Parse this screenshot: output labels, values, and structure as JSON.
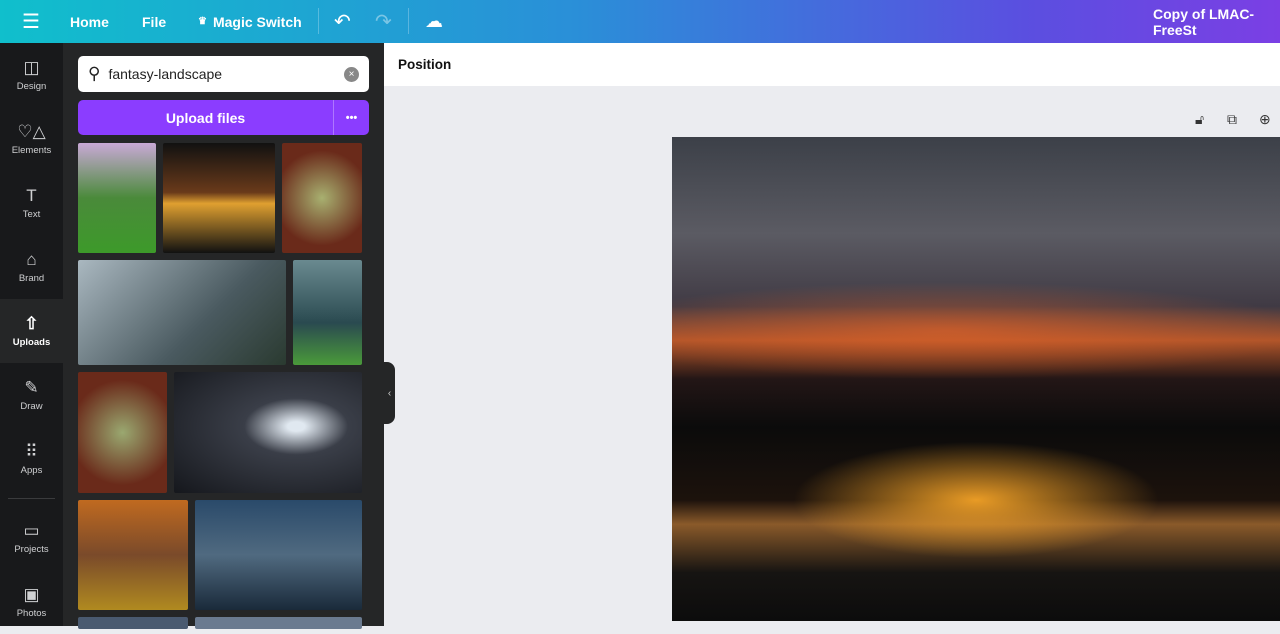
{
  "topbar": {
    "home": "Home",
    "file": "File",
    "magic_switch": "Magic Switch",
    "title": "Copy of LMAC-FreeSt"
  },
  "rail": [
    {
      "label": "Design",
      "icon": "layout-icon"
    },
    {
      "label": "Elements",
      "icon": "shapes-icon"
    },
    {
      "label": "Text",
      "icon": "text-icon"
    },
    {
      "label": "Brand",
      "icon": "brand-icon"
    },
    {
      "label": "Uploads",
      "icon": "upload-icon"
    },
    {
      "label": "Draw",
      "icon": "draw-icon"
    },
    {
      "label": "Apps",
      "icon": "apps-icon"
    },
    {
      "label": "Projects",
      "icon": "folder-icon"
    },
    {
      "label": "Photos",
      "icon": "image-icon"
    }
  ],
  "panel": {
    "search_value": "fantasy-landscape",
    "upload_label": "Upload files",
    "more": "•••"
  },
  "toolbar": {
    "position": "Position"
  }
}
